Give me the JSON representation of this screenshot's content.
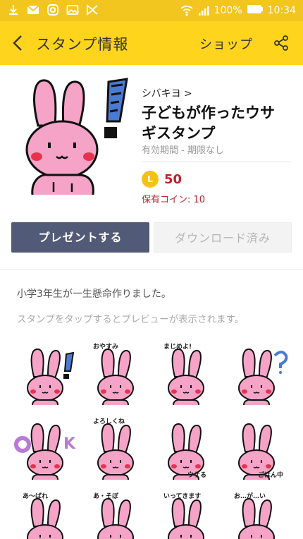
{
  "status_bar": {
    "battery": "100%",
    "time": "10:34"
  },
  "app_bar": {
    "title": "スタンプ情報",
    "shop_label": "ショップ"
  },
  "package": {
    "author": "シバキヨ >",
    "title": "子どもが作ったウサギスタンプ",
    "validity": "有効期間 - 期限なし",
    "coin_letter": "L",
    "price": "50",
    "owned_coins": "保有コイン: 10"
  },
  "buttons": {
    "present": "プレゼントする",
    "download": "ダウンロード済み"
  },
  "description": "小学3年生が一生懸命作りました。",
  "hint": "スタンプをタップするとプレビューが表示されます。",
  "stickers": [
    {
      "caption": ""
    },
    {
      "caption": "おやすみ"
    },
    {
      "caption": "まじめよ!"
    },
    {
      "caption": "?"
    },
    {
      "caption": "OK"
    },
    {
      "caption": "よろしくね"
    },
    {
      "caption": "ウケる"
    },
    {
      "caption": "ごはん中"
    },
    {
      "caption": "あ〜ばれ"
    },
    {
      "caption": "あ・そぼ"
    },
    {
      "caption": "いってきます"
    },
    {
      "caption": "お…が…い"
    }
  ],
  "colors": {
    "accent_yellow": "#ffd41d",
    "status_yellow": "#f2c51f",
    "present_button": "#515a76",
    "price_red": "#b8252d"
  }
}
